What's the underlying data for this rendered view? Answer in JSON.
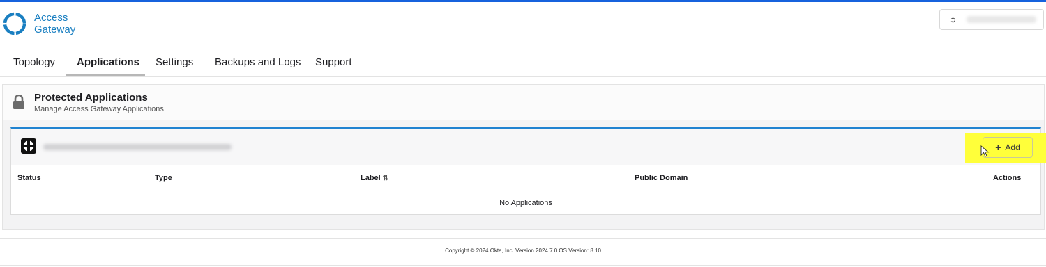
{
  "brand": {
    "line1": "Access",
    "line2": "Gateway",
    "color": "#1a7fc1"
  },
  "header": {
    "user_icon": "sign-out-icon"
  },
  "tabs": [
    {
      "label": "Topology"
    },
    {
      "label": "Applications",
      "active": true
    },
    {
      "label": "Settings"
    },
    {
      "label": "Backups and Logs"
    },
    {
      "label": "Support"
    }
  ],
  "section": {
    "title": "Protected Applications",
    "subtitle": "Manage Access Gateway Applications",
    "icon": "lock-icon"
  },
  "card": {
    "add_label": "Add",
    "columns": [
      "Status",
      "Type",
      "Label",
      "Public Domain",
      "Actions"
    ],
    "empty_text": "No Applications"
  },
  "footer": {
    "text": "Copyright © 2024 Okta, Inc. Version 2024.7.0 OS Version: 8.10"
  },
  "colors": {
    "accent": "#1662dd",
    "highlight": "#ffff3a"
  }
}
